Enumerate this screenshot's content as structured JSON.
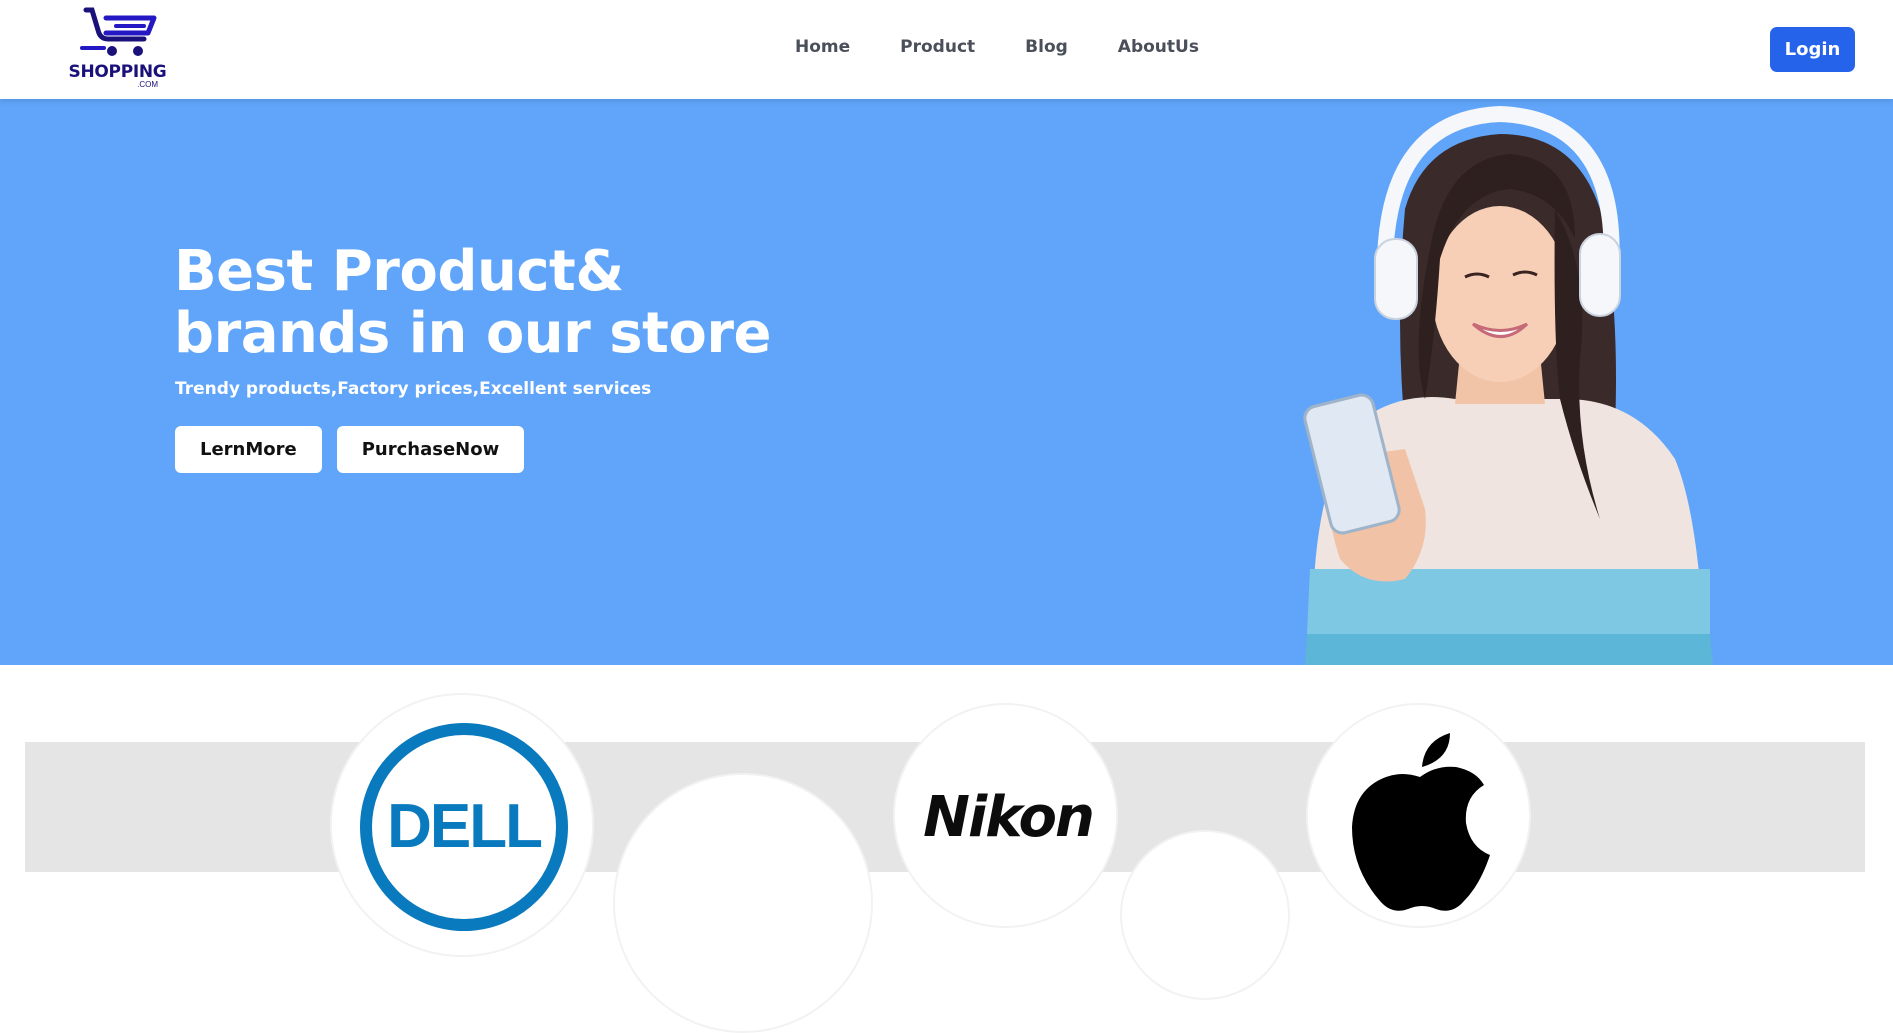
{
  "header": {
    "logo": {
      "name": "SHOPPING",
      "sub": ".COM",
      "icon": "shopping-cart-icon",
      "color": "#1a127a"
    },
    "nav": [
      "Home",
      "Product",
      "Blog",
      "AboutUs"
    ],
    "login_label": "Login"
  },
  "hero": {
    "title_line1": "Best Product&",
    "title_line2": "brands in our store",
    "subtitle": "Trendy products,Factory prices,Excellent services",
    "buttons": {
      "learn_more": "LernMore",
      "purchase_now": "PurchaseNow"
    },
    "background": "#60a5fa"
  },
  "brands": [
    {
      "name": "Dell",
      "icon": "dell-logo-icon"
    },
    {
      "name": "",
      "icon": "blank-circle"
    },
    {
      "name": "Nikon",
      "icon": "nikon-logo-icon"
    },
    {
      "name": "",
      "icon": "blank-circle"
    },
    {
      "name": "Apple",
      "icon": "apple-logo-icon"
    }
  ],
  "colors": {
    "accent": "#2563eb",
    "nav_text": "#4a4f5a",
    "brand_band": "#e5e5e5"
  }
}
